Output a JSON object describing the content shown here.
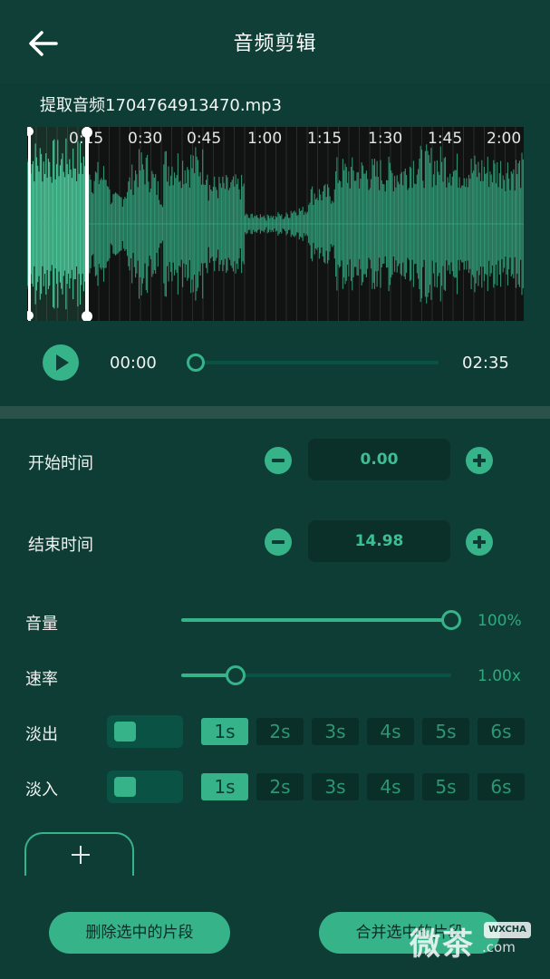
{
  "header": {
    "title": "音频剪辑",
    "back_icon": "arrow-left-icon"
  },
  "file": {
    "name": "提取音频1704764913470.mp3"
  },
  "waveform": {
    "tick_labels": [
      "0:15",
      "0:30",
      "0:45",
      "1:00",
      "1:15",
      "1:30",
      "1:45",
      "2:00"
    ],
    "wave_color": "#37b38a",
    "selected_color": "#4fcf9f"
  },
  "player": {
    "current_time": "00:00",
    "total_time": "02:35",
    "progress": 0
  },
  "trim": {
    "start_label": "开始时间",
    "start_value": "0.00",
    "end_label": "结束时间",
    "end_value": "14.98"
  },
  "volume": {
    "label": "音量",
    "value_text": "100%",
    "level": 1.0
  },
  "speed": {
    "label": "速率",
    "value_text": "1.00x",
    "level": 0.2
  },
  "fade_out": {
    "label": "淡出",
    "options": [
      "1s",
      "2s",
      "3s",
      "4s",
      "5s",
      "6s"
    ],
    "selected": "1s"
  },
  "fade_in": {
    "label": "淡入",
    "options": [
      "1s",
      "2s",
      "3s",
      "4s",
      "5s",
      "6s"
    ],
    "selected": "1s"
  },
  "actions": {
    "add_icon": "plus-icon",
    "delete_label": "删除选中的片段",
    "merge_label": "合并选中的片段"
  },
  "watermark": {
    "text": "微茶",
    "badge": "WXCHA",
    "domain": ".com"
  },
  "colors": {
    "background": "#0d3d35",
    "accent": "#37b38a",
    "panel": "#0b2f29"
  }
}
